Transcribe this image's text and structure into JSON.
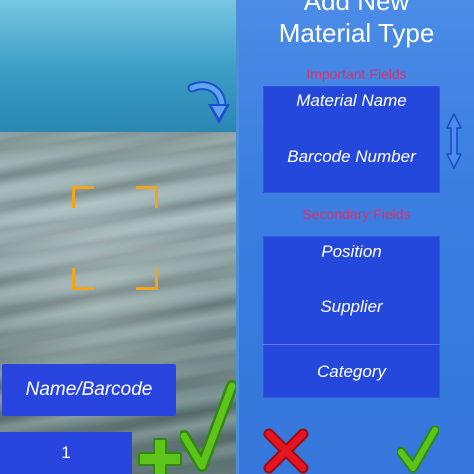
{
  "scanner": {
    "name_barcode_label": "Name/Barcode",
    "quantity_value": "1",
    "icons": {
      "swap": "curved-arrow-down-icon",
      "reticle": "scan-frame-icon",
      "add": "plus-icon",
      "confirm": "checkmark-icon"
    }
  },
  "form": {
    "title_line1": "Add New",
    "title_line2": "Material Type",
    "important_label": "Important Fields",
    "important_fields": [
      "Material Name",
      "Barcode Number"
    ],
    "secondary_label": "Secondary Fields",
    "secondary_fields": [
      "Position",
      "Supplier",
      "Category"
    ],
    "icons": {
      "scroll": "up-down-arrow-icon",
      "cancel": "x-icon",
      "confirm": "checkmark-icon"
    }
  },
  "colors": {
    "button_blue": "#2845e0",
    "panel_blue": "#3a7ee0",
    "section_label": "#e0306a",
    "reticle": "#f4a41a",
    "check_green": "#5ec41c",
    "cancel_red": "#e5141e"
  }
}
